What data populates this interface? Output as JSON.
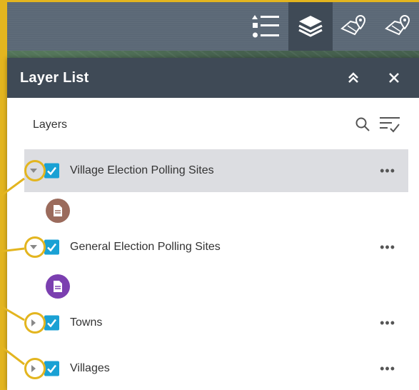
{
  "panel": {
    "title": "Layer List",
    "section_label": "Layers"
  },
  "layers": [
    {
      "label": "Village Election Polling Sites",
      "expanded": true,
      "checked": true,
      "selected": true,
      "symbol_color": "#9b6b5c",
      "more": "•••"
    },
    {
      "label": "General Election Polling Sites",
      "expanded": true,
      "checked": true,
      "selected": false,
      "symbol_color": "#7b3fb0",
      "more": "•••"
    },
    {
      "label": "Towns",
      "expanded": false,
      "checked": true,
      "selected": false,
      "more": "•••"
    },
    {
      "label": "Villages",
      "expanded": false,
      "checked": true,
      "selected": false,
      "more": "•••"
    }
  ],
  "toolbar": {
    "tools": [
      "legend-icon",
      "layers-icon",
      "map-pin-icon",
      "map-pin-icon"
    ]
  },
  "colors": {
    "header": "#3f4a56",
    "toolbar": "#5b6876",
    "checkbox": "#1aa1d4",
    "annotation": "#e3b51f"
  }
}
